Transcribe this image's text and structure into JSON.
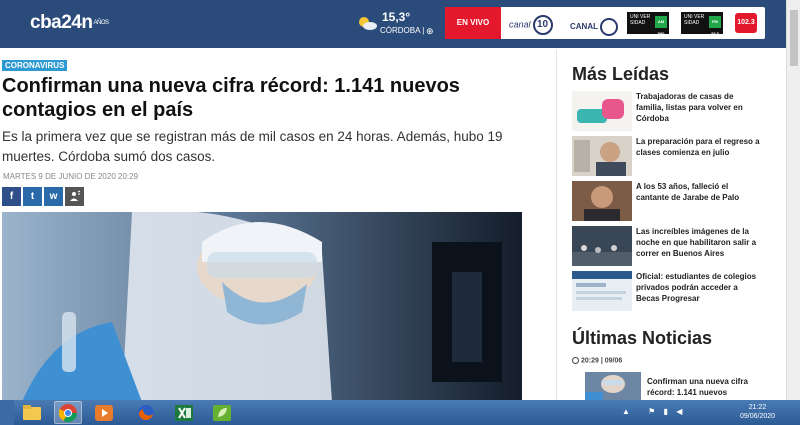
{
  "header": {
    "logo_text": "cba24n",
    "logo_small": "AÑOS",
    "temperature": "15,3°",
    "city": "CÓRDOBA |",
    "live_label": "EN VIVO",
    "canal10_label": "canal",
    "canal10_badge": "10",
    "canal12_label": "CANAL",
    "uni1_label": "UNI VER SIDAD",
    "uni1_freq": "AM 580",
    "uni2_label": "UNI VER SIDAD",
    "uni2_freq": "FM 88.5",
    "radio1023": "102.3"
  },
  "article": {
    "section_badge": "CORONAVIRUS",
    "headline": "Confirman una nueva cifra récord: 1.141 nuevos contagios en el país",
    "summary": "Es la primera vez que se registran más de mil casos en 24 horas. Además, hubo 19 muertes. Córdoba sumó dos casos.",
    "date": "MARTES 9 DE JUNIO DE 2020 20:29",
    "share": {
      "facebook": "f",
      "twitter": "t",
      "whatsapp": "w"
    }
  },
  "sidebar": {
    "most_read_title": "Más Leídas",
    "most_read": [
      {
        "title": "Trabajadoras de casas de familia, listas para volver en Córdoba"
      },
      {
        "title": "La preparación para el regreso a clases comienza en julio"
      },
      {
        "title": "A los 53 años, falleció el cantante de Jarabe de Palo"
      },
      {
        "title": "Las increíbles imágenes de la noche en que habilitaron salir a correr en Buenos Aires"
      },
      {
        "title": "Oficial: estudiantes de colegios privados podrán acceder a Becas Progresar"
      }
    ],
    "latest_title": "Últimas Noticias",
    "latest_time": "20:29 | 09/06",
    "latest_item": "Confirman una nueva cifra récord: 1.141 nuevos"
  },
  "taskbar": {
    "time": "21:22",
    "date": "09/06/2020"
  },
  "icons": {
    "weather": "partly-cloudy-icon",
    "location": "location-icon",
    "clock": "clock-icon"
  },
  "colors": {
    "header_bg": "#2b4c7a",
    "live_red": "#e3182d",
    "badge_blue": "#2d9ad1"
  }
}
